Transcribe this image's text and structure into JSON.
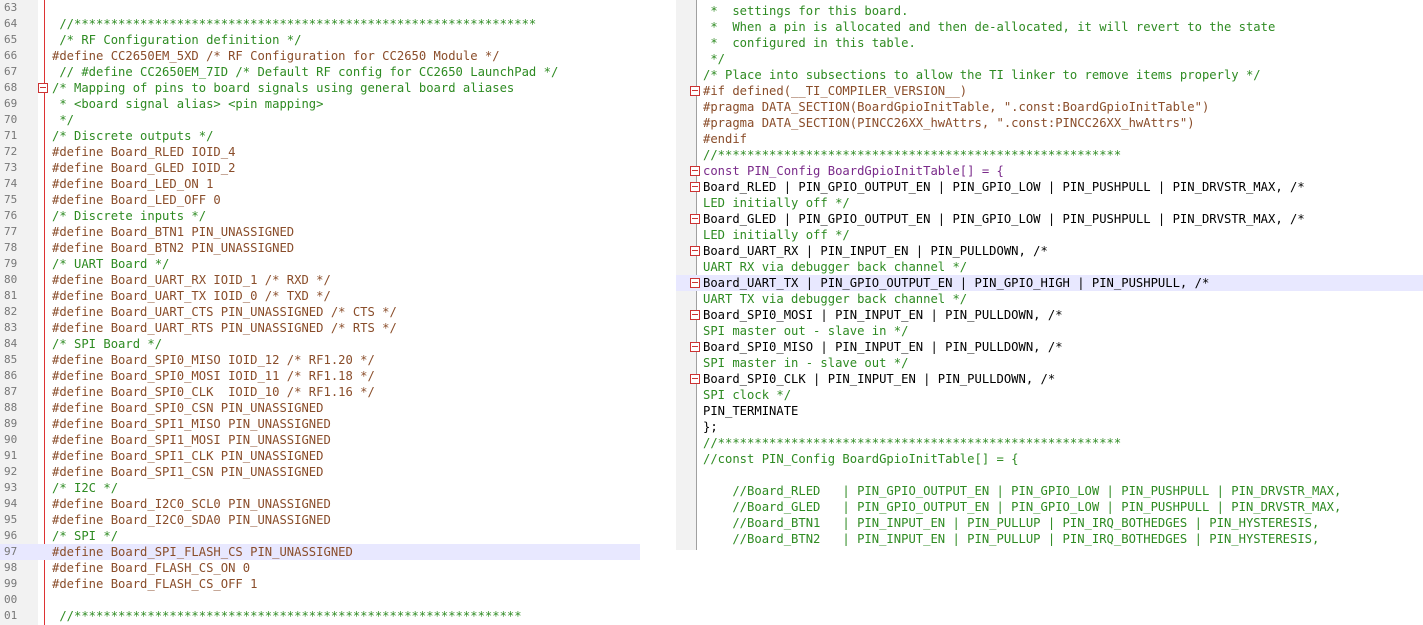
{
  "left_editor": {
    "lines": [
      {
        "n": "63",
        "t": "",
        "c": "c-txt"
      },
      {
        "n": "64",
        "t": " //***************************************************************",
        "c": "c-cmt"
      },
      {
        "n": "65",
        "t": " /* RF Configuration definition */",
        "c": "c-cmt"
      },
      {
        "n": "66",
        "t": "#define CC2650EM_5XD /* RF Configuration for CC2650 Module */",
        "c": "c-pp"
      },
      {
        "n": "67",
        "t": " // #define CC2650EM_7ID /* Default RF config for CC2650 LaunchPad */",
        "c": "c-cmt"
      },
      {
        "n": "68",
        "t": "/* Mapping of pins to board signals using general board aliases",
        "c": "c-cmt",
        "fold": true
      },
      {
        "n": "69",
        "t": " * <board signal alias> <pin mapping>",
        "c": "c-cmt"
      },
      {
        "n": "70",
        "t": " */",
        "c": "c-cmt"
      },
      {
        "n": "71",
        "t": "/* Discrete outputs */",
        "c": "c-cmt"
      },
      {
        "n": "72",
        "t": "#define Board_RLED IOID_4",
        "c": "c-pp"
      },
      {
        "n": "73",
        "t": "#define Board_GLED IOID_2",
        "c": "c-pp"
      },
      {
        "n": "74",
        "t": "#define Board_LED_ON 1",
        "c": "c-pp"
      },
      {
        "n": "75",
        "t": "#define Board_LED_OFF 0",
        "c": "c-pp"
      },
      {
        "n": "76",
        "t": "/* Discrete inputs */",
        "c": "c-cmt"
      },
      {
        "n": "77",
        "t": "#define Board_BTN1 PIN_UNASSIGNED",
        "c": "c-pp"
      },
      {
        "n": "78",
        "t": "#define Board_BTN2 PIN_UNASSIGNED",
        "c": "c-pp"
      },
      {
        "n": "79",
        "t": "/* UART Board */",
        "c": "c-cmt"
      },
      {
        "n": "80",
        "t": "#define Board_UART_RX IOID_1 /* RXD */",
        "c": "c-pp"
      },
      {
        "n": "81",
        "t": "#define Board_UART_TX IOID_0 /* TXD */",
        "c": "c-pp"
      },
      {
        "n": "82",
        "t": "#define Board_UART_CTS PIN_UNASSIGNED /* CTS */",
        "c": "c-pp"
      },
      {
        "n": "83",
        "t": "#define Board_UART_RTS PIN_UNASSIGNED /* RTS */",
        "c": "c-pp"
      },
      {
        "n": "84",
        "t": "/* SPI Board */",
        "c": "c-cmt"
      },
      {
        "n": "85",
        "t": "#define Board_SPI0_MISO IOID_12 /* RF1.20 */",
        "c": "c-pp"
      },
      {
        "n": "86",
        "t": "#define Board_SPI0_MOSI IOID_11 /* RF1.18 */",
        "c": "c-pp"
      },
      {
        "n": "87",
        "t": "#define Board_SPI0_CLK  IOID_10 /* RF1.16 */",
        "c": "c-pp"
      },
      {
        "n": "88",
        "t": "#define Board_SPI0_CSN PIN_UNASSIGNED",
        "c": "c-pp"
      },
      {
        "n": "89",
        "t": "#define Board_SPI1_MISO PIN_UNASSIGNED",
        "c": "c-pp"
      },
      {
        "n": "90",
        "t": "#define Board_SPI1_MOSI PIN_UNASSIGNED",
        "c": "c-pp"
      },
      {
        "n": "91",
        "t": "#define Board_SPI1_CLK PIN_UNASSIGNED",
        "c": "c-pp"
      },
      {
        "n": "92",
        "t": "#define Board_SPI1_CSN PIN_UNASSIGNED",
        "c": "c-pp"
      },
      {
        "n": "93",
        "t": "/* I2C */",
        "c": "c-cmt"
      },
      {
        "n": "94",
        "t": "#define Board_I2C0_SCL0 PIN_UNASSIGNED",
        "c": "c-pp"
      },
      {
        "n": "95",
        "t": "#define Board_I2C0_SDA0 PIN_UNASSIGNED",
        "c": "c-pp"
      },
      {
        "n": "96",
        "t": "/* SPI */",
        "c": "c-cmt"
      },
      {
        "n": "97",
        "t": "#define Board_SPI_FLASH_CS PIN_UNASSIGNED",
        "c": "c-pp",
        "hl": true
      },
      {
        "n": "98",
        "t": "#define Board_FLASH_CS_ON 0",
        "c": "c-pp"
      },
      {
        "n": "99",
        "t": "#define Board_FLASH_CS_OFF 1",
        "c": "c-pp"
      },
      {
        "n": "00",
        "t": "",
        "c": "c-txt"
      },
      {
        "n": "01",
        "t": " //*************************************************************",
        "c": "c-cmt"
      }
    ]
  },
  "right_editor": {
    "lines": [
      {
        "t": " *  settings for this board.",
        "c": "c-cmt"
      },
      {
        "t": " *  When a pin is allocated and then de-allocated, it will revert to the state",
        "c": "c-cmt"
      },
      {
        "t": " *  configured in this table.",
        "c": "c-cmt"
      },
      {
        "t": " */",
        "c": "c-cmt"
      },
      {
        "t": "/* Place into subsections to allow the TI linker to remove items properly */",
        "c": "c-cmt"
      },
      {
        "t": "#if defined(__TI_COMPILER_VERSION__)",
        "c": "c-pp",
        "fold": true
      },
      {
        "t": "#pragma DATA_SECTION(BoardGpioInitTable, \".const:BoardGpioInitTable\")",
        "c": "c-pp"
      },
      {
        "t": "#pragma DATA_SECTION(PINCC26XX_hwAttrs, \".const:PINCC26XX_hwAttrs\")",
        "c": "c-pp"
      },
      {
        "t": "#endif",
        "c": "c-pp"
      },
      {
        "t": "//*******************************************************",
        "c": "c-cmt"
      },
      {
        "t": "const PIN_Config BoardGpioInitTable[] = {",
        "c": "c-kw",
        "fold": true
      },
      {
        "t": "Board_RLED | PIN_GPIO_OUTPUT_EN | PIN_GPIO_LOW | PIN_PUSHPULL | PIN_DRVSTR_MAX, /*",
        "c": "c-txt",
        "fold": true
      },
      {
        "t": "LED initially off */",
        "c": "c-cmt"
      },
      {
        "t": "Board_GLED | PIN_GPIO_OUTPUT_EN | PIN_GPIO_LOW | PIN_PUSHPULL | PIN_DRVSTR_MAX, /*",
        "c": "c-txt",
        "fold": true
      },
      {
        "t": "LED initially off */",
        "c": "c-cmt"
      },
      {
        "t": "Board_UART_RX | PIN_INPUT_EN | PIN_PULLDOWN, /*",
        "c": "c-txt",
        "fold": true
      },
      {
        "t": "UART RX via debugger back channel */",
        "c": "c-cmt"
      },
      {
        "t": "Board_UART_TX | PIN_GPIO_OUTPUT_EN | PIN_GPIO_HIGH | PIN_PUSHPULL, /*",
        "c": "c-txt",
        "fold": true,
        "hl": true
      },
      {
        "t": "UART TX via debugger back channel */",
        "c": "c-cmt"
      },
      {
        "t": "Board_SPI0_MOSI | PIN_INPUT_EN | PIN_PULLDOWN, /*",
        "c": "c-txt",
        "fold": true
      },
      {
        "t": "SPI master out - slave in */",
        "c": "c-cmt"
      },
      {
        "t": "Board_SPI0_MISO | PIN_INPUT_EN | PIN_PULLDOWN, /*",
        "c": "c-txt",
        "fold": true
      },
      {
        "t": "SPI master in - slave out */",
        "c": "c-cmt"
      },
      {
        "t": "Board_SPI0_CLK | PIN_INPUT_EN | PIN_PULLDOWN, /*",
        "c": "c-txt",
        "fold": true
      },
      {
        "t": "SPI clock */",
        "c": "c-cmt"
      },
      {
        "t": "PIN_TERMINATE",
        "c": "c-txt"
      },
      {
        "t": "};",
        "c": "c-txt"
      },
      {
        "t": "//*******************************************************",
        "c": "c-cmt"
      },
      {
        "t": "//const PIN_Config BoardGpioInitTable[] = {",
        "c": "c-cmt"
      },
      {
        "t": "",
        "c": "c-txt"
      },
      {
        "t": "    //Board_RLED   | PIN_GPIO_OUTPUT_EN | PIN_GPIO_LOW | PIN_PUSHPULL | PIN_DRVSTR_MAX,",
        "c": "c-cmt"
      },
      {
        "t": "    //Board_GLED   | PIN_GPIO_OUTPUT_EN | PIN_GPIO_LOW | PIN_PUSHPULL | PIN_DRVSTR_MAX,",
        "c": "c-cmt"
      },
      {
        "t": "    //Board_BTN1   | PIN_INPUT_EN | PIN_PULLUP | PIN_IRQ_BOTHEDGES | PIN_HYSTERESIS,",
        "c": "c-cmt"
      },
      {
        "t": "    //Board_BTN2   | PIN_INPUT_EN | PIN_PULLUP | PIN_IRQ_BOTHEDGES | PIN_HYSTERESIS,",
        "c": "c-cmt"
      }
    ]
  }
}
